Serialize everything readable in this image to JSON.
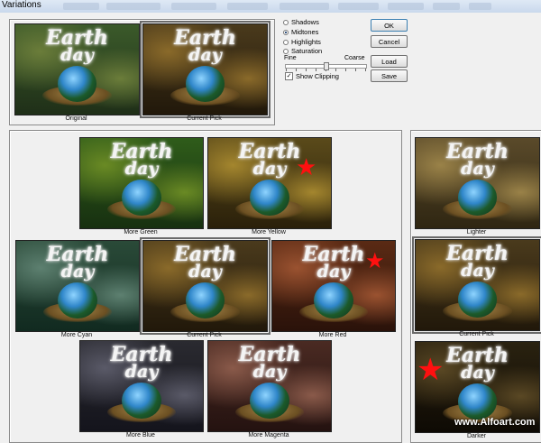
{
  "window": {
    "title": "Variations"
  },
  "modes": {
    "shadows": "Shadows",
    "midtones": "Midtones",
    "highlights": "Highlights",
    "saturation": "Saturation",
    "selected": "midtones"
  },
  "slider": {
    "fine": "Fine",
    "coarse": "Coarse",
    "level": 0.5
  },
  "show_clipping": {
    "label": "Show Clipping",
    "checked": true
  },
  "buttons": {
    "ok": "OK",
    "cancel": "Cancel",
    "load": "Load",
    "save": "Save"
  },
  "artwork": {
    "title_line1": "Earth",
    "title_line2": "day"
  },
  "thumbnails": {
    "original": "Original",
    "current_pick_top": "Current Pick",
    "more_green": "More Green",
    "more_yellow": "More Yellow",
    "more_cyan": "More Cyan",
    "current_pick_center": "Current Pick",
    "more_red": "More Red",
    "more_blue": "More Blue",
    "more_magenta": "More Magenta",
    "lighter": "Lighter",
    "current_pick_right": "Current Pick",
    "darker": "Darker"
  },
  "watermark": "www.Alfoart.com",
  "colors": {
    "star": "#ff1010",
    "dialog_bg": "#f0f0f0",
    "default_button_border": "#3c7fb1"
  }
}
